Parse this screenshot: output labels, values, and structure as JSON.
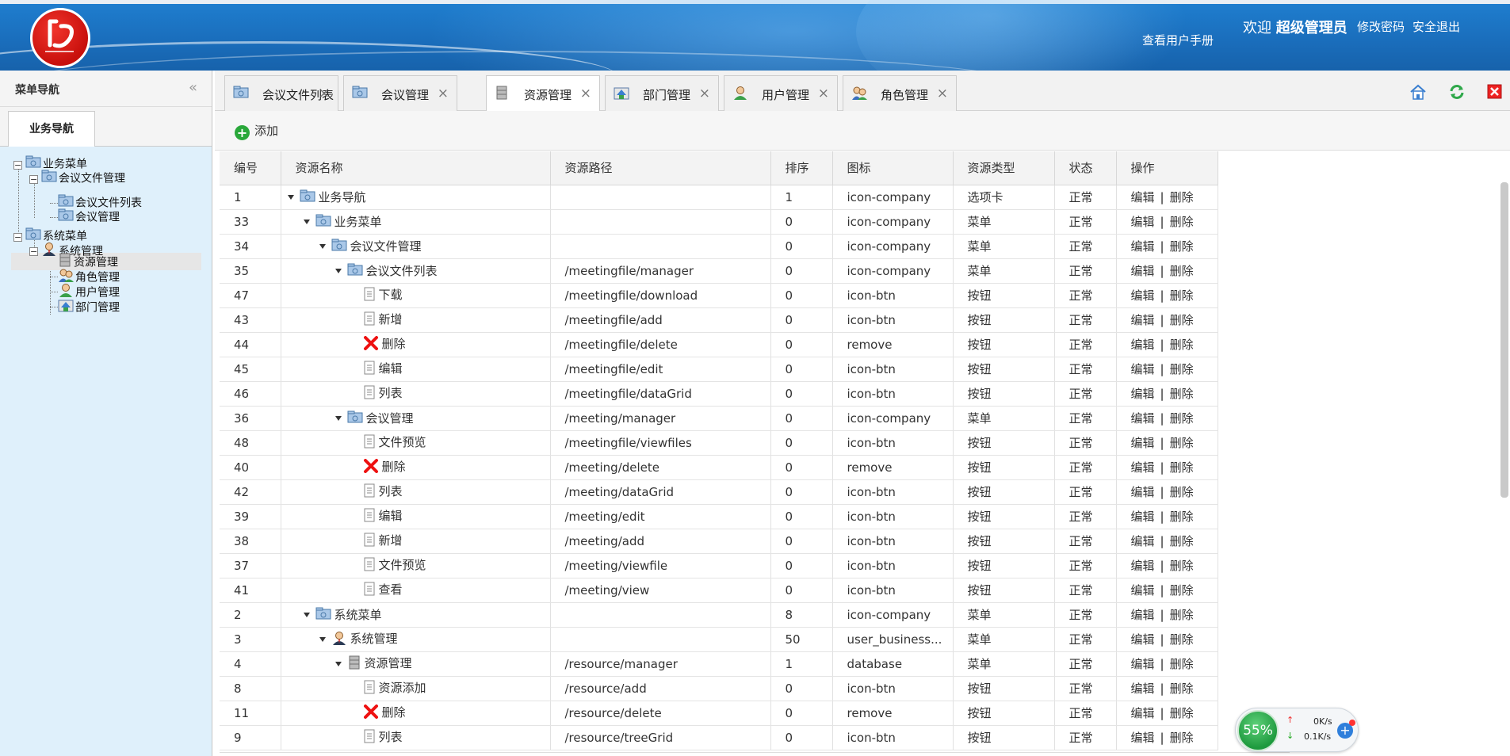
{
  "header": {
    "manual_link": "查看用户手册",
    "welcome_prefix": "欢迎",
    "username": "超级管理员",
    "change_password": "修改密码",
    "logout": "安全退出"
  },
  "left_panel": {
    "title": "菜单导航",
    "tab": "业务导航",
    "tree": [
      {
        "label": "业务菜单",
        "icon": "folder-icon"
      },
      {
        "label": "会议文件管理",
        "icon": "folder-icon"
      },
      {
        "label": "会议文件列表",
        "icon": "folder-icon"
      },
      {
        "label": "会议管理",
        "icon": "folder-icon"
      },
      {
        "label": "系统菜单",
        "icon": "folder-icon"
      },
      {
        "label": "系统管理",
        "icon": "user-business-icon"
      },
      {
        "label": "资源管理",
        "icon": "database-icon"
      },
      {
        "label": "角色管理",
        "icon": "users-icon"
      },
      {
        "label": "用户管理",
        "icon": "user-icon"
      },
      {
        "label": "部门管理",
        "icon": "department-icon"
      }
    ]
  },
  "main_tabs": [
    {
      "label": "会议文件列表",
      "icon": "folder-icon"
    },
    {
      "label": "会议管理",
      "icon": "folder-icon"
    },
    {
      "label": "资源管理",
      "icon": "database-icon",
      "active": true
    },
    {
      "label": "部门管理",
      "icon": "department-icon"
    },
    {
      "label": "用户管理",
      "icon": "user-icon"
    },
    {
      "label": "角色管理",
      "icon": "users-icon"
    }
  ],
  "toolbar": {
    "add_label": "添加"
  },
  "grid": {
    "columns": [
      "编号",
      "资源名称",
      "资源路径",
      "排序",
      "图标",
      "资源类型",
      "状态",
      "操作"
    ],
    "edit_label": "编辑",
    "delete_label": "删除",
    "op_separator": "|",
    "rows": [
      {
        "id": "1",
        "name": "业务导航",
        "depth": 0,
        "expand": true,
        "ricon": "folder",
        "path": "",
        "sort": "1",
        "icon": "icon-company",
        "type": "选项卡",
        "status": "正常"
      },
      {
        "id": "33",
        "name": "业务菜单",
        "depth": 1,
        "expand": true,
        "ricon": "folder",
        "path": "",
        "sort": "0",
        "icon": "icon-company",
        "type": "菜单",
        "status": "正常"
      },
      {
        "id": "34",
        "name": "会议文件管理",
        "depth": 2,
        "expand": true,
        "ricon": "folder",
        "path": "",
        "sort": "0",
        "icon": "icon-company",
        "type": "菜单",
        "status": "正常"
      },
      {
        "id": "35",
        "name": "会议文件列表",
        "depth": 3,
        "expand": true,
        "ricon": "folder",
        "path": "/meetingfile/manager",
        "sort": "0",
        "icon": "icon-company",
        "type": "菜单",
        "status": "正常"
      },
      {
        "id": "47",
        "name": "下载",
        "depth": 4,
        "expand": false,
        "ricon": "doc",
        "path": "/meetingfile/download",
        "sort": "0",
        "icon": "icon-btn",
        "type": "按钮",
        "status": "正常"
      },
      {
        "id": "43",
        "name": "新增",
        "depth": 4,
        "expand": false,
        "ricon": "doc",
        "path": "/meetingfile/add",
        "sort": "0",
        "icon": "icon-btn",
        "type": "按钮",
        "status": "正常"
      },
      {
        "id": "44",
        "name": "删除",
        "depth": 4,
        "expand": false,
        "ricon": "remove",
        "path": "/meetingfile/delete",
        "sort": "0",
        "icon": "remove",
        "type": "按钮",
        "status": "正常"
      },
      {
        "id": "45",
        "name": "编辑",
        "depth": 4,
        "expand": false,
        "ricon": "doc",
        "path": "/meetingfile/edit",
        "sort": "0",
        "icon": "icon-btn",
        "type": "按钮",
        "status": "正常"
      },
      {
        "id": "46",
        "name": "列表",
        "depth": 4,
        "expand": false,
        "ricon": "doc",
        "path": "/meetingfile/dataGrid",
        "sort": "0",
        "icon": "icon-btn",
        "type": "按钮",
        "status": "正常"
      },
      {
        "id": "36",
        "name": "会议管理",
        "depth": 3,
        "expand": true,
        "ricon": "folder",
        "path": "/meeting/manager",
        "sort": "0",
        "icon": "icon-company",
        "type": "菜单",
        "status": "正常"
      },
      {
        "id": "48",
        "name": "文件预览",
        "depth": 4,
        "expand": false,
        "ricon": "doc",
        "path": "/meetingfile/viewfiles",
        "sort": "0",
        "icon": "icon-btn",
        "type": "按钮",
        "status": "正常"
      },
      {
        "id": "40",
        "name": "删除",
        "depth": 4,
        "expand": false,
        "ricon": "remove",
        "path": "/meeting/delete",
        "sort": "0",
        "icon": "remove",
        "type": "按钮",
        "status": "正常"
      },
      {
        "id": "42",
        "name": "列表",
        "depth": 4,
        "expand": false,
        "ricon": "doc",
        "path": "/meeting/dataGrid",
        "sort": "0",
        "icon": "icon-btn",
        "type": "按钮",
        "status": "正常"
      },
      {
        "id": "39",
        "name": "编辑",
        "depth": 4,
        "expand": false,
        "ricon": "doc",
        "path": "/meeting/edit",
        "sort": "0",
        "icon": "icon-btn",
        "type": "按钮",
        "status": "正常"
      },
      {
        "id": "38",
        "name": "新增",
        "depth": 4,
        "expand": false,
        "ricon": "doc",
        "path": "/meeting/add",
        "sort": "0",
        "icon": "icon-btn",
        "type": "按钮",
        "status": "正常"
      },
      {
        "id": "37",
        "name": "文件预览",
        "depth": 4,
        "expand": false,
        "ricon": "doc",
        "path": "/meeting/viewfile",
        "sort": "0",
        "icon": "icon-btn",
        "type": "按钮",
        "status": "正常"
      },
      {
        "id": "41",
        "name": "查看",
        "depth": 4,
        "expand": false,
        "ricon": "doc",
        "path": "/meeting/view",
        "sort": "0",
        "icon": "icon-btn",
        "type": "按钮",
        "status": "正常"
      },
      {
        "id": "2",
        "name": "系统菜单",
        "depth": 1,
        "expand": true,
        "ricon": "folder",
        "path": "",
        "sort": "8",
        "icon": "icon-company",
        "type": "菜单",
        "status": "正常"
      },
      {
        "id": "3",
        "name": "系统管理",
        "depth": 2,
        "expand": true,
        "ricon": "user",
        "path": "",
        "sort": "50",
        "icon": "user_business...",
        "type": "菜单",
        "status": "正常"
      },
      {
        "id": "4",
        "name": "资源管理",
        "depth": 3,
        "expand": true,
        "ricon": "db",
        "path": "/resource/manager",
        "sort": "1",
        "icon": "database",
        "type": "菜单",
        "status": "正常"
      },
      {
        "id": "8",
        "name": "资源添加",
        "depth": 4,
        "expand": false,
        "ricon": "doc",
        "path": "/resource/add",
        "sort": "0",
        "icon": "icon-btn",
        "type": "按钮",
        "status": "正常"
      },
      {
        "id": "11",
        "name": "删除",
        "depth": 4,
        "expand": false,
        "ricon": "remove",
        "path": "/resource/delete",
        "sort": "0",
        "icon": "remove",
        "type": "按钮",
        "status": "正常"
      },
      {
        "id": "9",
        "name": "列表",
        "depth": 4,
        "expand": false,
        "ricon": "doc",
        "path": "/resource/treeGrid",
        "sort": "0",
        "icon": "icon-btn",
        "type": "按钮",
        "status": "正常"
      }
    ]
  },
  "speed_widget": {
    "percent": "55%",
    "up": "0K/s",
    "down": "0.1K/s"
  }
}
